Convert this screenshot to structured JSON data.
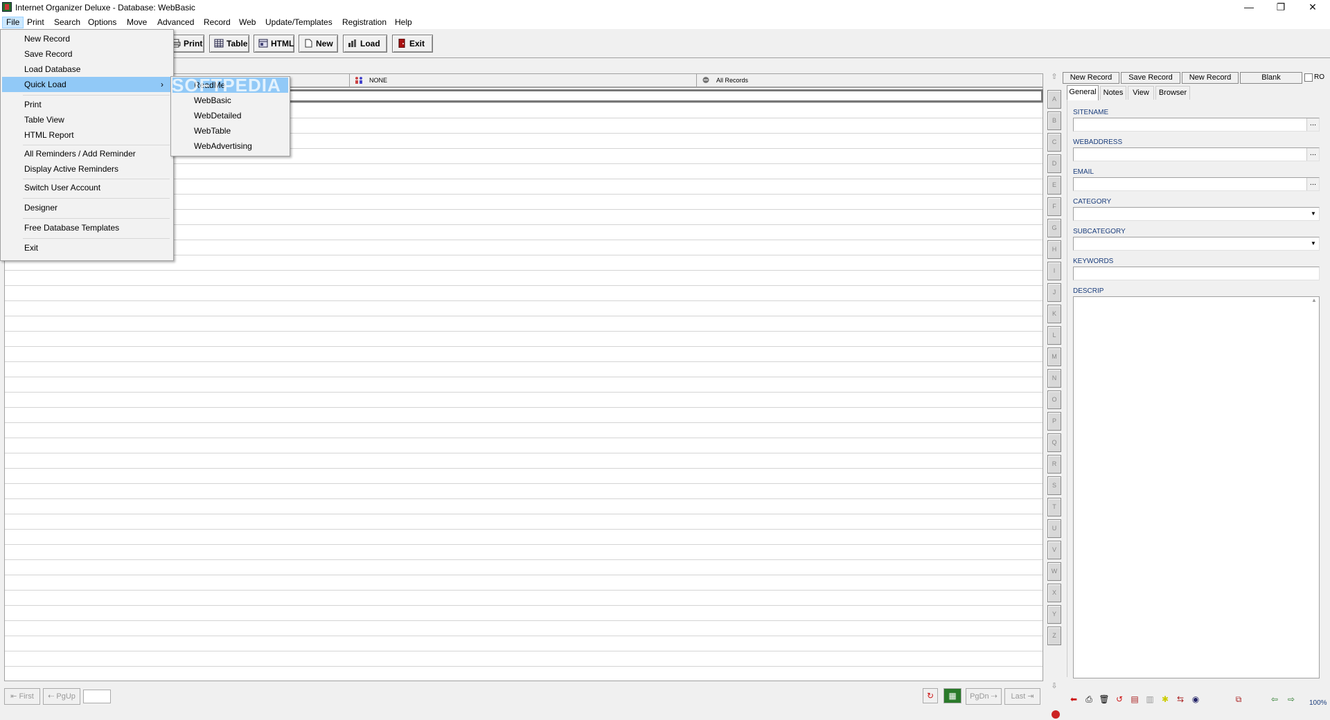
{
  "window": {
    "title": "Internet Organizer Deluxe - Database: WebBasic",
    "minimize": "—",
    "restore": "❐",
    "close": "✕"
  },
  "menubar": [
    "File",
    "Print",
    "Search",
    "Options",
    "Move",
    "Advanced",
    "Record",
    "Web",
    "Update/Templates",
    "Registration",
    "Help"
  ],
  "toolbar": {
    "print": "Print",
    "table": "Table",
    "html": "HTML",
    "new": "New",
    "load": "Load",
    "exit": "Exit"
  },
  "grid_header": {
    "col2": "NONE",
    "col3": "All Records"
  },
  "alphabet": [
    "A",
    "B",
    "C",
    "D",
    "E",
    "F",
    "G",
    "H",
    "I",
    "J",
    "K",
    "L",
    "M",
    "N",
    "O",
    "P",
    "Q",
    "R",
    "S",
    "T",
    "U",
    "V",
    "W",
    "X",
    "Y",
    "Z"
  ],
  "right_panel": {
    "top_buttons": [
      "New Record",
      "Save Record",
      "New Record",
      "Blank"
    ],
    "ro_label": "RO",
    "tabs": [
      "General",
      "Notes",
      "View",
      "Browser"
    ],
    "fields": {
      "sitename": "SITENAME",
      "webaddress": "WEBADDRESS",
      "email": "EMAIL",
      "category": "CATEGORY",
      "subcategory": "SUBCATEGORY",
      "keywords": "KEYWORDS",
      "descrip": "DESCRIP"
    },
    "ellipsis": "...",
    "zoom": "100%"
  },
  "bottom_nav": {
    "first": "First",
    "pgup": "PgUp",
    "pgdn": "PgDn",
    "last": "Last"
  },
  "file_menu": {
    "items": [
      "New Record",
      "Save Record",
      "Load Database",
      "Quick Load",
      "Print",
      "Table View",
      "HTML Report",
      "All Reminders / Add Reminder",
      "Display Active Reminders",
      "Switch User Account",
      "Designer",
      "Free Database Templates",
      "Exit"
    ],
    "submenu_arrow": "›"
  },
  "quick_load_submenu": [
    "ReadMe",
    "WebBasic",
    "WebDetailed",
    "WebTable",
    "WebAdvertising"
  ],
  "watermark": "SOFTPEDIA"
}
